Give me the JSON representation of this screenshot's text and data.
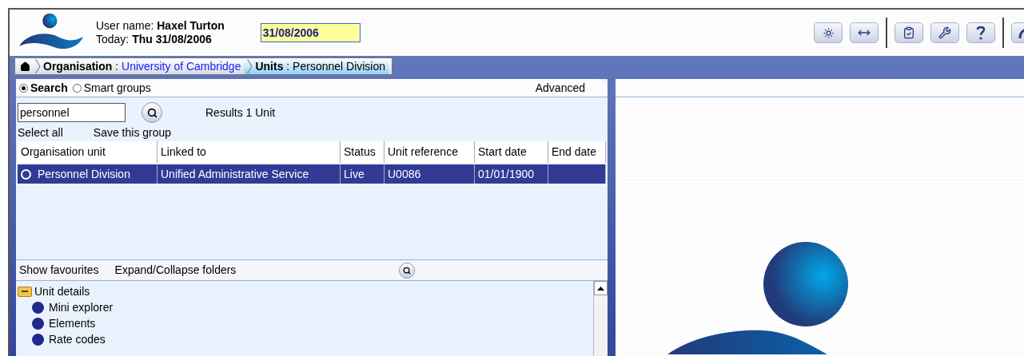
{
  "header": {
    "user_label": "User name:",
    "user_name": "Haxel Turton",
    "today_label": "Today:",
    "today_value": "Thu 31/08/2006",
    "date_field": "31/08/2006"
  },
  "breadcrumb": [
    {
      "label": "Organisation",
      "separator": ":",
      "value": "University of Cambridge",
      "selected": false
    },
    {
      "label": "Units",
      "separator": ":",
      "value": "Personnel Division",
      "selected": true
    }
  ],
  "search_modes": [
    {
      "label": "Search",
      "selected": true
    },
    {
      "label": "Smart groups",
      "selected": false
    }
  ],
  "advanced": "Advanced",
  "search_field": {
    "value": "personnel"
  },
  "results": "Results 1 Unit",
  "actions": [
    "Select all",
    "Save this group"
  ],
  "table": {
    "columns": [
      "Organisation unit",
      "Linked to",
      "Status",
      "Unit reference",
      "Start date",
      "End date"
    ],
    "rows": [
      {
        "cells": [
          "Personnel Division",
          "Unified Administrative Service",
          "Live",
          "U0086",
          "01/01/1900",
          ""
        ],
        "selected": true
      }
    ]
  },
  "tree_toolbar": [
    "Show favourites",
    "Expand/Collapse folders"
  ],
  "tree": [
    {
      "label": "Unit details",
      "expanded": true,
      "children": [
        {
          "label": "Mini explorer"
        },
        {
          "label": "Elements"
        },
        {
          "label": "Rate codes"
        }
      ]
    }
  ]
}
